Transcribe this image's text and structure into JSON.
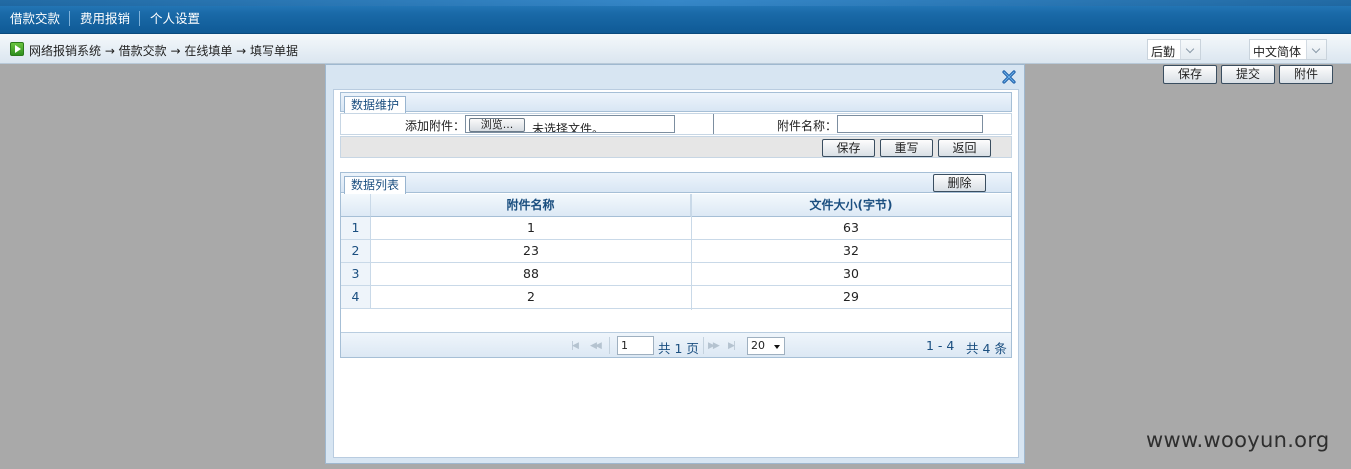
{
  "nav": {
    "items": [
      "借款交款",
      "费用报销",
      "个人设置"
    ]
  },
  "breadcrumb": "网络报销系统 → 借款交款 → 在线填单 → 填写单据",
  "header_controls": {
    "role_select": "后勤",
    "language_select": "中文简体"
  },
  "toolbar": {
    "save": "保存",
    "submit": "提交",
    "attachment": "附件"
  },
  "dialog": {
    "maintenance_tab": "数据维护",
    "add_attachment_label": "添加附件：",
    "browse_button": "浏览...",
    "file_status": "未选择文件。",
    "attachment_name_label": "附件名称：",
    "attachment_name_value": "",
    "save": "保存",
    "reset": "重写",
    "back": "返回",
    "list_tab": "数据列表",
    "delete": "删除",
    "columns": [
      "附件名称",
      "文件大小(字节)"
    ],
    "rows": [
      {
        "num": "1",
        "name": "1",
        "size": "63"
      },
      {
        "num": "2",
        "name": "23",
        "size": "32"
      },
      {
        "num": "3",
        "name": "88",
        "size": "30"
      },
      {
        "num": "4",
        "name": "2",
        "size": "29"
      }
    ],
    "pager": {
      "page": "1",
      "total_pages": "共 1 页",
      "page_size": "20",
      "range": "1 - 4",
      "total": "共 4 条"
    }
  },
  "watermark": "www.wooyun.org"
}
